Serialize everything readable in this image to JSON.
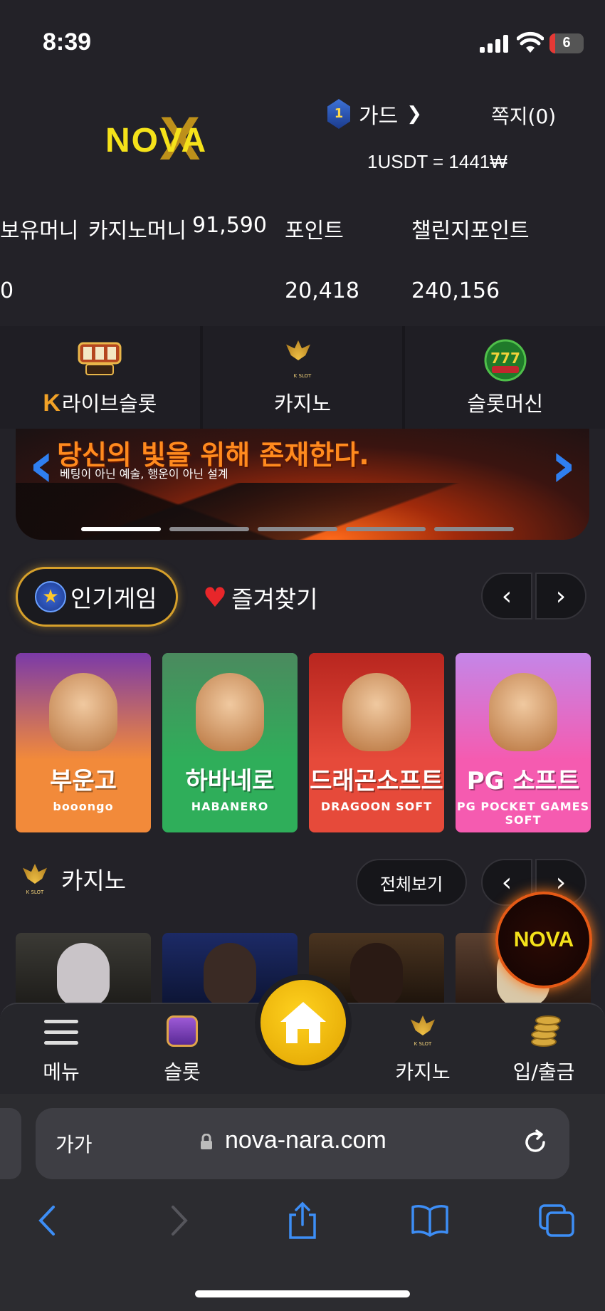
{
  "status_bar": {
    "time": "8:39",
    "battery": "6"
  },
  "header": {
    "logo_text": "NOVA",
    "rank_level": "1",
    "rank_name": "가드",
    "messages": "쪽지(0)",
    "exchange_rate": "1USDT = 1441₩"
  },
  "balances": {
    "hold_label": "보유머니",
    "casino_label": "카지노머니",
    "casino_value": "91,590",
    "point_label": "포인트",
    "challenge_label": "챌린지포인트",
    "hold_value": "0",
    "point_value": "20,418",
    "challenge_value": "240,156"
  },
  "categories": [
    {
      "label": "라이브슬롯",
      "icon": "live-slot-icon",
      "prefix": "K"
    },
    {
      "label": "카지노",
      "icon": "k-slot-lotus-icon"
    },
    {
      "label": "슬롯머신",
      "icon": "777-slots-icon"
    }
  ],
  "banner": {
    "headline": "당신의 빛을 위해 존재한다.",
    "subtitle": "베팅이 아닌 예술, 행운이 아닌 설계",
    "slide_count": 5,
    "active_slide": 1
  },
  "tabs": {
    "popular": "인기게임",
    "favorites": "즐겨찾기"
  },
  "games": [
    {
      "title": "부운고",
      "brand": "booongo",
      "color": "#f28a3a",
      "art": "#7b3aa8"
    },
    {
      "title": "하바네로",
      "brand": "HABANERO",
      "color": "#2fae5a",
      "art": "#4b8a5e"
    },
    {
      "title": "드래곤소프트",
      "brand": "DRAGOON SOFT",
      "color": "#e64a3a",
      "art": "#b8261f"
    },
    {
      "title": "PG 소프트",
      "brand": "PG POCKET GAMES SOFT",
      "color": "#f55bb0",
      "art": "#c486e8"
    }
  ],
  "casino": {
    "title": "카지노",
    "view_all": "전체보기"
  },
  "bottom_nav": {
    "menu": "메뉴",
    "slot": "슬롯",
    "casino": "카지노",
    "deposit": "입/출금"
  },
  "browser": {
    "text_size": "가가",
    "host": "nova-nara.com"
  },
  "colors": {
    "gold": "#d6a02b",
    "accent_blue": "#2f7ff0",
    "home_yellow": "#ffd21f"
  }
}
